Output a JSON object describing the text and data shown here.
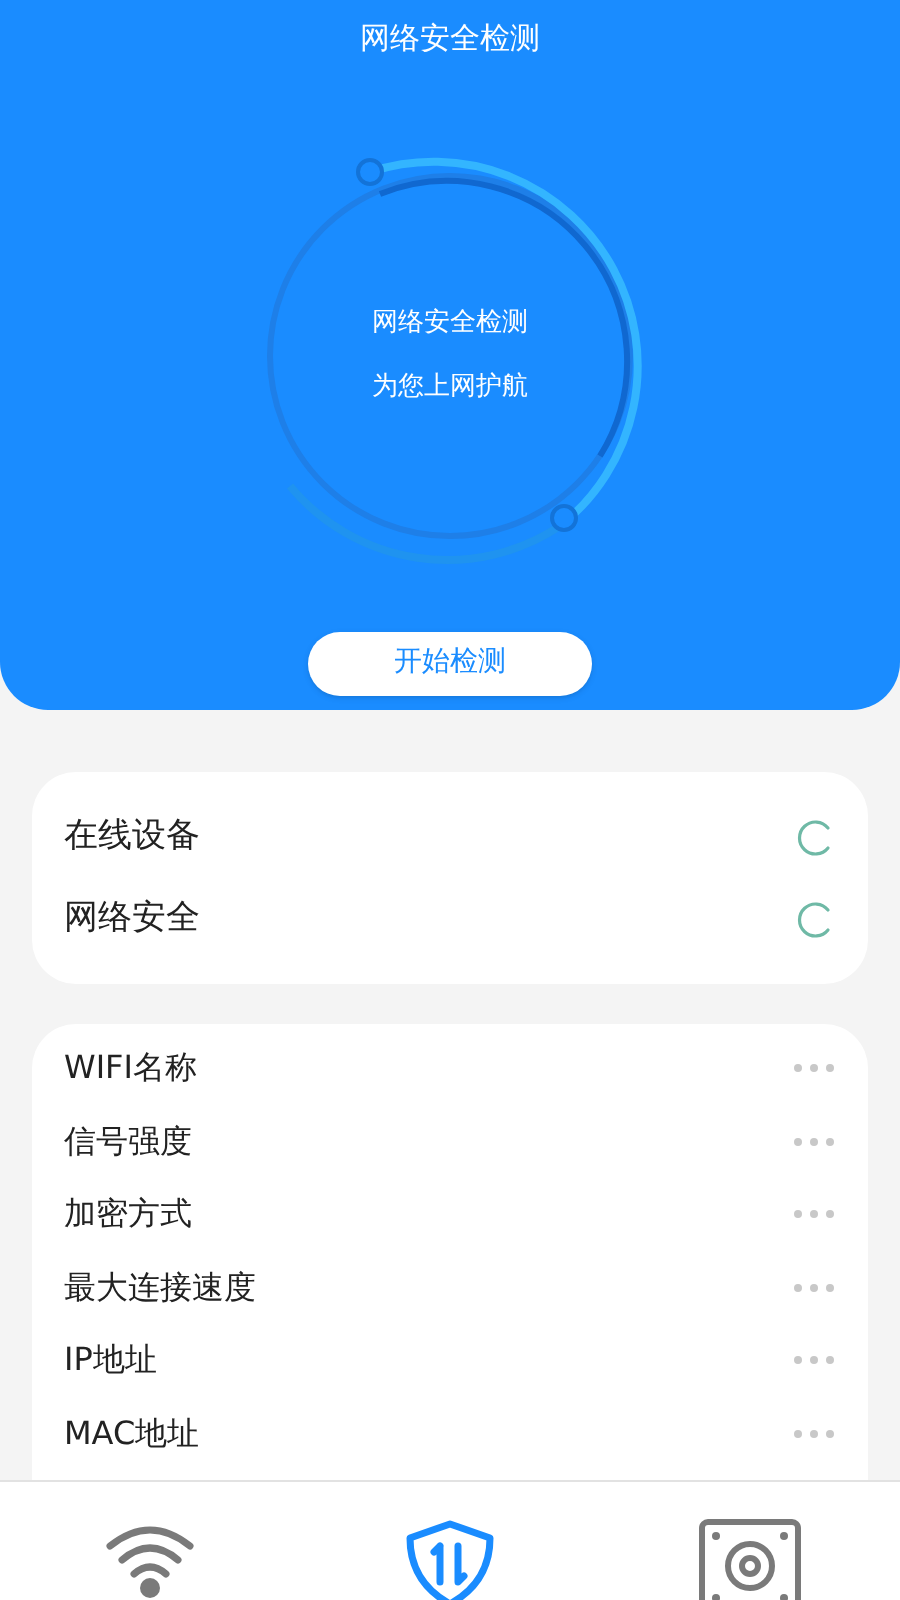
{
  "header": {
    "title": "网络安全检测",
    "ring_line_1": "网络安全检测",
    "ring_line_2": "为您上网护航",
    "start_button": "开始检测"
  },
  "status_card": [
    {
      "label": "在线设备"
    },
    {
      "label": "网络安全"
    }
  ],
  "info_card": [
    {
      "label": "WIFI名称"
    },
    {
      "label": "信号强度"
    },
    {
      "label": "加密方式"
    },
    {
      "label": "最大连接速度"
    },
    {
      "label": "IP地址"
    },
    {
      "label": "MAC地址"
    }
  ],
  "bottom_tabs": [
    {
      "kind": "wifi",
      "selected": false
    },
    {
      "kind": "shield",
      "selected": true
    },
    {
      "kind": "device",
      "selected": false
    }
  ]
}
